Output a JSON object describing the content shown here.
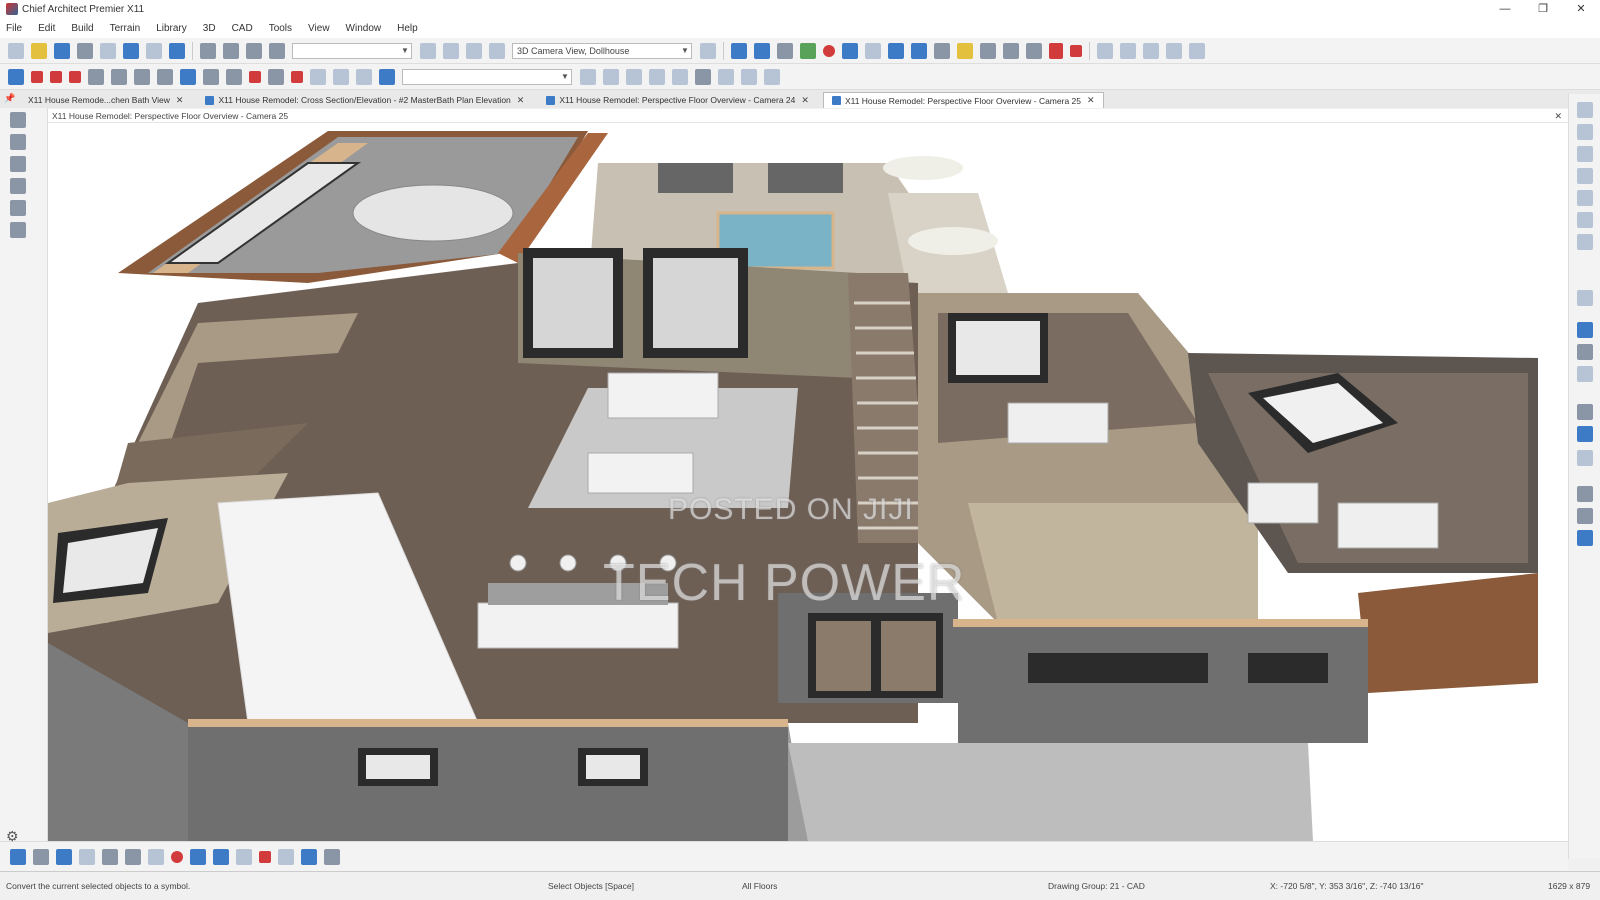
{
  "window": {
    "title": "Chief Architect Premier X11",
    "controls": [
      "—",
      "❐",
      "✕"
    ]
  },
  "menu": [
    "File",
    "Edit",
    "Build",
    "Terrain",
    "Library",
    "3D",
    "CAD",
    "Tools",
    "View",
    "Window",
    "Help"
  ],
  "toolbar": {
    "camera_combo": "3D Camera View, Dollhouse"
  },
  "tabs": [
    {
      "label": "X11 House Remode...chen Bath View",
      "active": false
    },
    {
      "label": "X11 House Remodel: Cross Section/Elevation - #2 MasterBath Plan Elevation",
      "active": false
    },
    {
      "label": "X11 House Remodel: Perspective Floor Overview - Camera 24",
      "active": false
    },
    {
      "label": "X11 House Remodel: Perspective Floor Overview - Camera 25",
      "active": true
    }
  ],
  "view_header": "X11 House Remodel: Perspective Floor Overview - Camera 25",
  "watermark": {
    "line1": "POSTED ON JIJI",
    "line2": "TECH POWER"
  },
  "status": {
    "hint": "Convert the current selected objects to a symbol.",
    "mode": "Select Objects [Space]",
    "floors": "All Floors",
    "group": "Drawing Group: 21 - CAD",
    "coords": "X: -720 5/8\", Y: 353 3/16\", Z: -740 13/16\"",
    "size": "1629 x 879"
  },
  "colors": {
    "floor_wood": "#6e5f55",
    "wall_top": "#d7b48c",
    "wall_grey": "#6f6f6f",
    "wall_tan": "#a89a84",
    "siding_brown": "#8a5a3a",
    "pool": "#7ab3c5",
    "rug": "#c9c9c9"
  }
}
